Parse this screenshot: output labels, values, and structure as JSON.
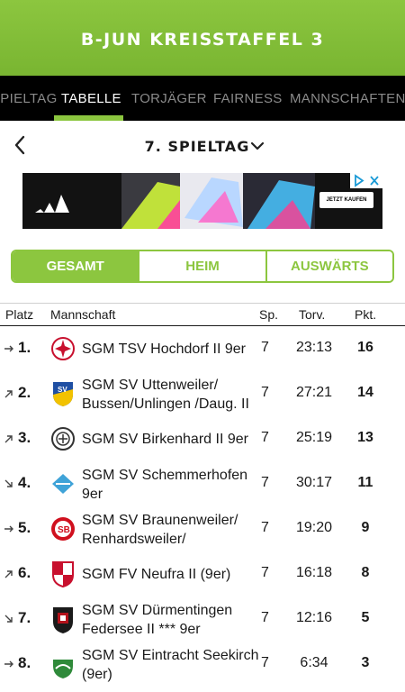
{
  "header": {
    "title": "B-JUN KREISSTAFFEL 3"
  },
  "tabs": [
    {
      "label": "SPIELTAG",
      "active": false
    },
    {
      "label": "TABELLE",
      "active": true
    },
    {
      "label": "TORJÄGER",
      "active": false
    },
    {
      "label": "FAIRNESS",
      "active": false
    },
    {
      "label": "MANNSCHAFTEN",
      "active": false
    }
  ],
  "matchday": {
    "label": "7. SPIELTAG"
  },
  "ad": {
    "cta": "JETZT KAUFEN"
  },
  "filter": {
    "options": [
      "GESAMT",
      "HEIM",
      "AUSWÄRTS"
    ],
    "selected": "GESAMT"
  },
  "table": {
    "columns": {
      "place": "Platz",
      "team": "Mannschaft",
      "played": "Sp.",
      "goals": "Torv.",
      "points": "Pkt."
    },
    "rows": [
      {
        "trend": "same",
        "place": "1.",
        "team_line1": "SGM TSV Hochdorf II  9er",
        "team_line2": "",
        "played": "7",
        "goals": "23:13",
        "points": "16",
        "crest_color": "#c8102e"
      },
      {
        "trend": "up",
        "place": "2.",
        "team_line1": "SGM SV Uttenweiler/",
        "team_line2": "Bussen/Unlingen /Daug. II",
        "played": "7",
        "goals": "27:21",
        "points": "14",
        "crest_color": "#1f4fa3"
      },
      {
        "trend": "up",
        "place": "3.",
        "team_line1": "SGM SV Birkenhard II 9er",
        "team_line2": "",
        "played": "7",
        "goals": "25:19",
        "points": "13",
        "crest_color": "#333333"
      },
      {
        "trend": "down",
        "place": "4.",
        "team_line1": "SGM SV Schemmerhofen",
        "team_line2": "9er",
        "played": "7",
        "goals": "30:17",
        "points": "11",
        "crest_color": "#3fa3d8"
      },
      {
        "trend": "same",
        "place": "5.",
        "team_line1": "SGM SV Braunenweiler/",
        "team_line2": "Renhardsweiler/",
        "played": "7",
        "goals": "19:20",
        "points": "9",
        "crest_color": "#d0101e"
      },
      {
        "trend": "up",
        "place": "6.",
        "team_line1": "SGM FV Neufra II (9er)",
        "team_line2": "",
        "played": "7",
        "goals": "16:18",
        "points": "8",
        "crest_color": "#c8102e"
      },
      {
        "trend": "down",
        "place": "7.",
        "team_line1": "SGM SV Dürmentingen",
        "team_line2": "Federsee II *** 9er",
        "played": "7",
        "goals": "12:16",
        "points": "5",
        "crest_color": "#b3121b"
      },
      {
        "trend": "same",
        "place": "8.",
        "team_line1": "SGM SV Eintracht Seekirch",
        "team_line2": "(9er)",
        "played": "7",
        "goals": "6:34",
        "points": "3",
        "crest_color": "#2f8a3a"
      }
    ]
  },
  "colors": {
    "accent": "#8cc63f",
    "tabbar": "#000000"
  }
}
